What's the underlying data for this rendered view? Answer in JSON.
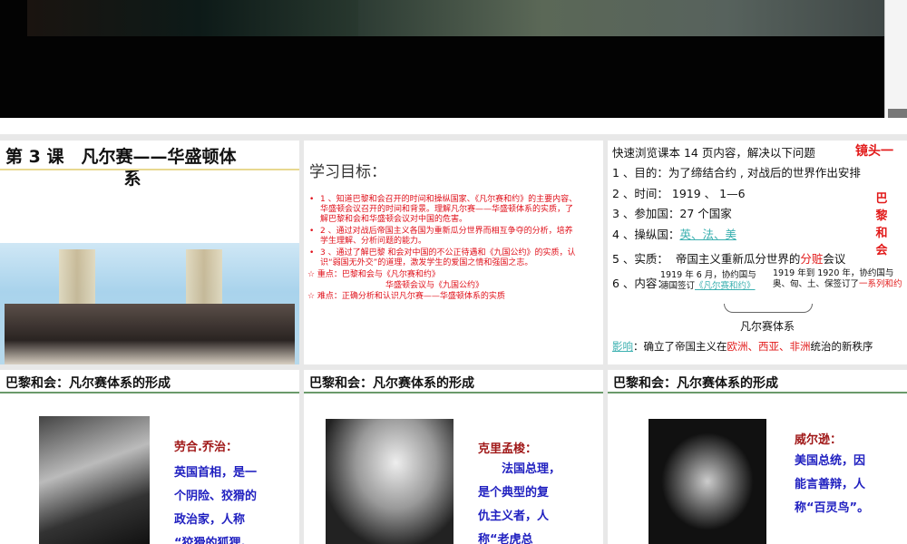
{
  "slide1": {
    "title_line1": "第 3 课　凡尔赛——华盛顿体",
    "title_line2": "系"
  },
  "slide2": {
    "heading": "学习目标：",
    "goals": [
      "1 、知道巴黎和会召开的时间和操纵国家、《凡尔赛和约》的主要内容、华盛顿会议召开的时间和背景。理解凡尔赛——华盛顿体系的实质，了解巴黎和会和华盛顿会议对中国的危害。",
      "2 、通过对战后帝国主义各国为重新瓜分世界而相互争夺的分析，培养学生理解、分析问题的能力。",
      "3 、通过了解巴黎 和会对中国的不公正待遇和《九国公约》的实质，认识“弱国无外交”的道理，激发学生的爱国之情和强国之志。"
    ],
    "key1": "☆ 重点：巴黎和会与《凡尔赛和约》",
    "key2": "华盛顿会议与《九国公约》",
    "difficulty": "☆ 难点：正确分析和认识凡尔赛——华盛顿体系的实质"
  },
  "slide3": {
    "intro": "快速浏览课本 14 页内容，解决以下问题",
    "camera": "镜头一",
    "vertical": "巴黎和会",
    "q1": "1 、目的：为了缔结合约 , 对战后的世界作出安排",
    "q2": "2 、时间：  1919 、 1—6",
    "q3": "3 、参加国：27 个国家",
    "q4_label": "4 、操纵国：",
    "q4_value": "英、法、美",
    "q5_label": "5 、实质：",
    "q5_a": "帝国主义重新瓜分世界的",
    "q5_red": "分赃",
    "q5_b": "会议",
    "q6_label": "6 、内容：",
    "c1a": "1919 年 6 月，协约国与",
    "c1b": "德国签订",
    "c1link": "《凡尔赛和约》",
    "c2a": "1919 年到 1920 年，协约国与",
    "c2b": "奥、匈、土、保签订了",
    "c2red": "一系列和约",
    "system": "凡尔赛体系",
    "effect_label": "影响",
    "effect_a": "：确立了帝国主义在",
    "effect_red": "欧洲、西亚、非洲",
    "effect_b": "统治的新秩序"
  },
  "bottom_heading": "巴黎和会：凡尔赛体系的形成",
  "people": [
    {
      "name": "劳合.乔治：",
      "lines": [
        "英国首相，是一",
        "个阴险、狡猾的",
        "政治家，人称",
        "“狡猾的狐狸。"
      ]
    },
    {
      "name": "克里孟梭：",
      "lines": [
        "　　法国总理，",
        "是个典型的复",
        "仇主义者，人",
        "称“老虎总"
      ]
    },
    {
      "name": "威尔逊：",
      "lines": [
        "美国总统，因",
        "能言善辩，人",
        "称“百灵鸟”。"
      ]
    }
  ]
}
